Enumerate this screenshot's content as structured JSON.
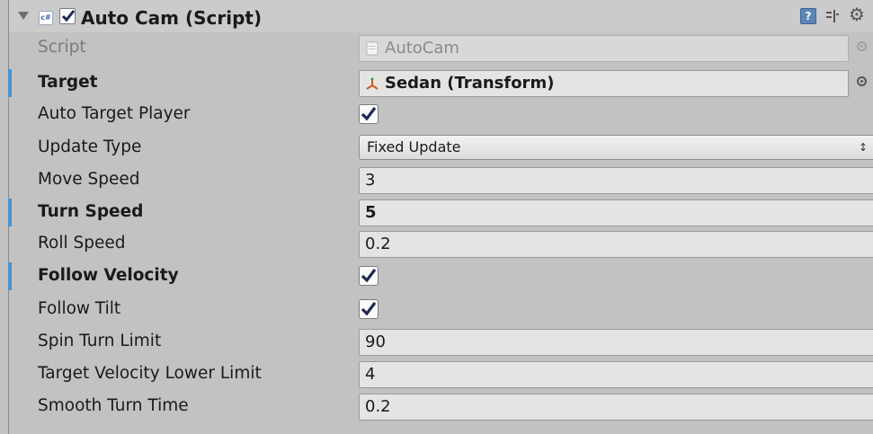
{
  "component": {
    "title": "Auto Cam (Script)",
    "enabled": true,
    "script_icon_text": "c#",
    "help_icon_text": "?"
  },
  "fields": {
    "script": {
      "label": "Script",
      "value": "AutoCam"
    },
    "target": {
      "label": "Target",
      "value": "Sedan (Transform)"
    },
    "auto_target_player": {
      "label": "Auto Target Player",
      "checked": true
    },
    "update_type": {
      "label": "Update Type",
      "value": "Fixed Update",
      "arrows": "↕"
    },
    "move_speed": {
      "label": "Move Speed",
      "value": "3"
    },
    "turn_speed": {
      "label": "Turn Speed",
      "value": "5"
    },
    "roll_speed": {
      "label": "Roll Speed",
      "value": "0.2"
    },
    "follow_velocity": {
      "label": "Follow Velocity",
      "checked": true
    },
    "follow_tilt": {
      "label": "Follow Tilt",
      "checked": true
    },
    "spin_turn_limit": {
      "label": "Spin Turn Limit",
      "value": "90"
    },
    "target_velocity_lower_limit": {
      "label": "Target Velocity Lower Limit",
      "value": "4"
    },
    "smooth_turn_time": {
      "label": "Smooth Turn Time",
      "value": "0.2"
    }
  },
  "colors": {
    "panel_bg": "#c2c2c2",
    "modified_bar": "#4a93cd",
    "field_bg": "#e4e4e4"
  }
}
